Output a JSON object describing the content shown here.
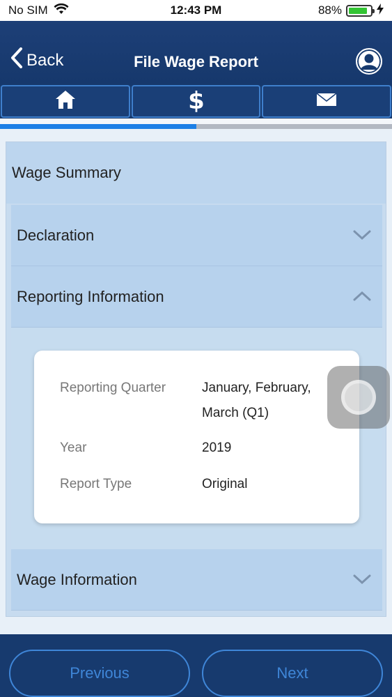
{
  "status_bar": {
    "carrier": "No SIM",
    "time": "12:43 PM",
    "battery_percent": "88%",
    "battery_level": 0.88
  },
  "header": {
    "back_label": "Back",
    "title": "File Wage Report"
  },
  "tabs": [
    {
      "icon": "home-icon"
    },
    {
      "icon": "dollar-icon"
    },
    {
      "icon": "mail-icon"
    }
  ],
  "progress": {
    "fraction": 0.5
  },
  "summary": {
    "title": "Wage Summary",
    "sections": [
      {
        "label": "Declaration",
        "expanded": false
      },
      {
        "label": "Reporting Information",
        "expanded": true
      },
      {
        "label": "Wage Information",
        "expanded": false
      }
    ],
    "reporting_info": {
      "quarter_label": "Reporting Quarter",
      "quarter_value_line1": "January, February,",
      "quarter_value_line2": "March (Q1)",
      "year_label": "Year",
      "year_value": "2019",
      "type_label": "Report Type",
      "type_value": "Original"
    }
  },
  "footer": {
    "previous_label": "Previous",
    "next_label": "Next"
  },
  "colors": {
    "header_bg": "#173a6e",
    "accent_blue": "#3f86d8",
    "progress_fill": "#1c7fe6",
    "accordion_bg": "#b7d2ed"
  }
}
